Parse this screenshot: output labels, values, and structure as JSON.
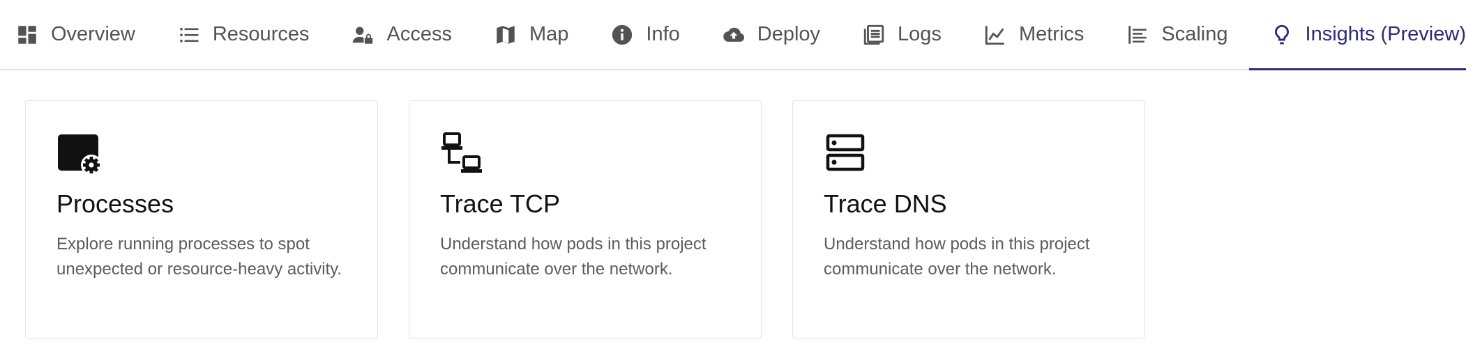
{
  "tabs": [
    {
      "label": "Overview",
      "icon": "dashboard-icon",
      "active": false
    },
    {
      "label": "Resources",
      "icon": "list-icon",
      "active": false
    },
    {
      "label": "Access",
      "icon": "user-lock-icon",
      "active": false
    },
    {
      "label": "Map",
      "icon": "map-icon",
      "active": false
    },
    {
      "label": "Info",
      "icon": "info-icon",
      "active": false
    },
    {
      "label": "Deploy",
      "icon": "cloud-upload-icon",
      "active": false
    },
    {
      "label": "Logs",
      "icon": "logs-icon",
      "active": false
    },
    {
      "label": "Metrics",
      "icon": "line-chart-icon",
      "active": false
    },
    {
      "label": "Scaling",
      "icon": "scaling-icon",
      "active": false
    },
    {
      "label": "Insights (Preview)",
      "icon": "lightbulb-icon",
      "active": true
    }
  ],
  "cards": [
    {
      "title": "Processes",
      "description": "Explore running processes to spot unexpected or resource-heavy activity.",
      "icon": "window-gear-icon"
    },
    {
      "title": "Trace TCP",
      "description": "Understand how pods in this project communicate over the network.",
      "icon": "network-computers-icon"
    },
    {
      "title": "Trace DNS",
      "description": "Understand how pods in this project communicate over the network.",
      "icon": "server-dns-icon"
    }
  ],
  "colors": {
    "accent": "#2d2a7a",
    "tab_text": "#525257",
    "border": "#e4e4e7"
  }
}
